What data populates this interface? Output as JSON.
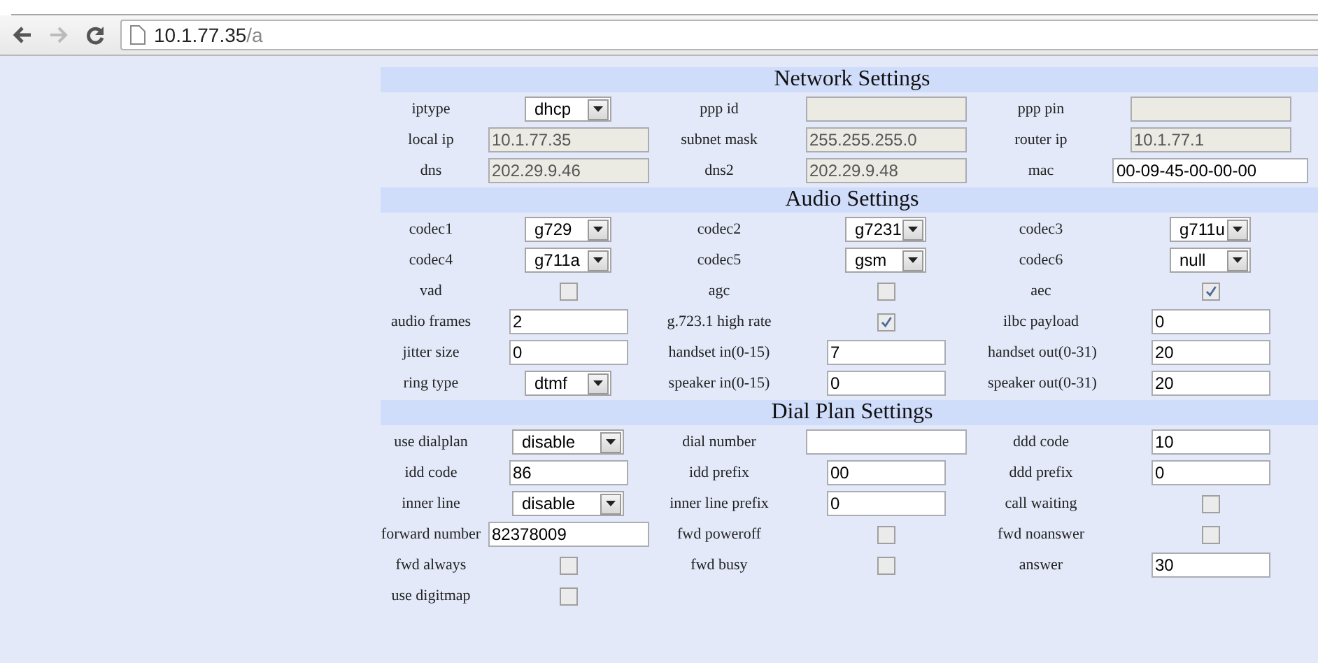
{
  "browser": {
    "back": {
      "disabled": false
    },
    "forward": {
      "disabled": true
    },
    "url_host": "10.1.77.35",
    "url_path": "/a"
  },
  "sections": [
    {
      "title": "Network Settings",
      "rows": [
        [
          {
            "kind": "label",
            "text": "iptype"
          },
          {
            "kind": "select",
            "value": "dhcp"
          },
          {
            "kind": "label",
            "text": "ppp id"
          },
          {
            "kind": "text",
            "disabled": true
          },
          {
            "kind": "label",
            "text": "ppp pin"
          },
          {
            "kind": "text",
            "disabled": true
          }
        ],
        [
          {
            "kind": "label",
            "text": "local ip"
          },
          {
            "kind": "text",
            "value": "10.1.77.35",
            "disabled": true
          },
          {
            "kind": "label",
            "text": "subnet mask"
          },
          {
            "kind": "text",
            "value": "255.255.255.0",
            "disabled": true
          },
          {
            "kind": "label",
            "text": "router ip"
          },
          {
            "kind": "text",
            "value": "10.1.77.1",
            "disabled": true
          }
        ],
        [
          {
            "kind": "label",
            "text": "dns"
          },
          {
            "kind": "text",
            "value": "202.29.9.46",
            "disabled": true
          },
          {
            "kind": "label",
            "text": "dns2"
          },
          {
            "kind": "text",
            "value": "202.29.9.48",
            "disabled": true
          },
          {
            "kind": "label",
            "text": "mac"
          },
          {
            "kind": "text",
            "value": "00-09-45-00-00-00",
            "disabled": false
          }
        ]
      ]
    },
    {
      "title": "Audio Settings",
      "rows": [
        [
          {
            "kind": "label",
            "text": "codec1"
          },
          {
            "kind": "select",
            "value": "g729"
          },
          {
            "kind": "label",
            "text": "codec2"
          },
          {
            "kind": "select",
            "value": "g7231"
          },
          {
            "kind": "label",
            "text": "codec3"
          },
          {
            "kind": "select",
            "value": "g711u"
          }
        ],
        [
          {
            "kind": "label",
            "text": "codec4"
          },
          {
            "kind": "select",
            "value": "g711a"
          },
          {
            "kind": "label",
            "text": "codec5"
          },
          {
            "kind": "select",
            "value": "gsm"
          },
          {
            "kind": "label",
            "text": "codec6"
          },
          {
            "kind": "select",
            "value": "null"
          }
        ],
        [
          {
            "kind": "label",
            "text": "vad"
          },
          {
            "kind": "checkbox",
            "checked": false
          },
          {
            "kind": "label",
            "text": "agc"
          },
          {
            "kind": "checkbox",
            "checked": false
          },
          {
            "kind": "label",
            "text": "aec"
          },
          {
            "kind": "checkbox",
            "checked": true
          }
        ],
        [
          {
            "kind": "label",
            "text": "audio frames"
          },
          {
            "kind": "text",
            "value": "2",
            "disabled": false
          },
          {
            "kind": "label",
            "text": "g.723.1 high rate"
          },
          {
            "kind": "checkbox",
            "checked": true
          },
          {
            "kind": "label",
            "text": "ilbc payload"
          },
          {
            "kind": "text",
            "value": "0",
            "disabled": false
          }
        ],
        [
          {
            "kind": "label",
            "text": "jitter size"
          },
          {
            "kind": "text",
            "value": "0",
            "disabled": false
          },
          {
            "kind": "label",
            "text": "handset in(0-15)"
          },
          {
            "kind": "text",
            "value": "7",
            "disabled": false
          },
          {
            "kind": "label",
            "text": "handset out(0-31)"
          },
          {
            "kind": "text",
            "value": "20",
            "disabled": false
          }
        ],
        [
          {
            "kind": "label",
            "text": "ring type"
          },
          {
            "kind": "select",
            "value": "dtmf"
          },
          {
            "kind": "label",
            "text": "speaker in(0-15)"
          },
          {
            "kind": "text",
            "value": "0",
            "disabled": false
          },
          {
            "kind": "label",
            "text": "speaker out(0-31)"
          },
          {
            "kind": "text",
            "value": "20",
            "disabled": false
          }
        ]
      ]
    },
    {
      "title": "Dial Plan Settings",
      "rows": [
        [
          {
            "kind": "label",
            "text": "use dialplan"
          },
          {
            "kind": "select",
            "value": "disable"
          },
          {
            "kind": "label",
            "text": "dial number"
          },
          {
            "kind": "text",
            "disabled": false
          },
          {
            "kind": "label",
            "text": "ddd code"
          },
          {
            "kind": "text",
            "value": "10",
            "disabled": false
          }
        ],
        [
          {
            "kind": "label",
            "text": "idd code"
          },
          {
            "kind": "text",
            "value": "86",
            "disabled": false
          },
          {
            "kind": "label",
            "text": "idd prefix"
          },
          {
            "kind": "text",
            "value": "00",
            "disabled": false
          },
          {
            "kind": "label",
            "text": "ddd prefix"
          },
          {
            "kind": "text",
            "value": "0",
            "disabled": false
          }
        ],
        [
          {
            "kind": "label",
            "text": "inner line"
          },
          {
            "kind": "select",
            "value": "disable"
          },
          {
            "kind": "label",
            "text": "inner line prefix"
          },
          {
            "kind": "text",
            "value": "0",
            "disabled": false
          },
          {
            "kind": "label",
            "text": "call waiting"
          },
          {
            "kind": "checkbox",
            "checked": false
          }
        ],
        [
          {
            "kind": "label",
            "text": "forward number"
          },
          {
            "kind": "text",
            "value": "82378009",
            "disabled": false
          },
          {
            "kind": "label",
            "text": "fwd poweroff"
          },
          {
            "kind": "checkbox",
            "checked": false
          },
          {
            "kind": "label",
            "text": "fwd noanswer"
          },
          {
            "kind": "checkbox",
            "checked": false
          }
        ],
        [
          {
            "kind": "label",
            "text": "fwd always"
          },
          {
            "kind": "checkbox",
            "checked": false
          },
          {
            "kind": "label",
            "text": "fwd busy"
          },
          {
            "kind": "checkbox",
            "checked": false
          },
          {
            "kind": "label",
            "text": "answer"
          },
          {
            "kind": "text",
            "value": "30",
            "disabled": false
          }
        ],
        [
          {
            "kind": "label",
            "text": "use digitmap"
          },
          {
            "kind": "checkbox",
            "checked": false
          }
        ]
      ]
    }
  ]
}
